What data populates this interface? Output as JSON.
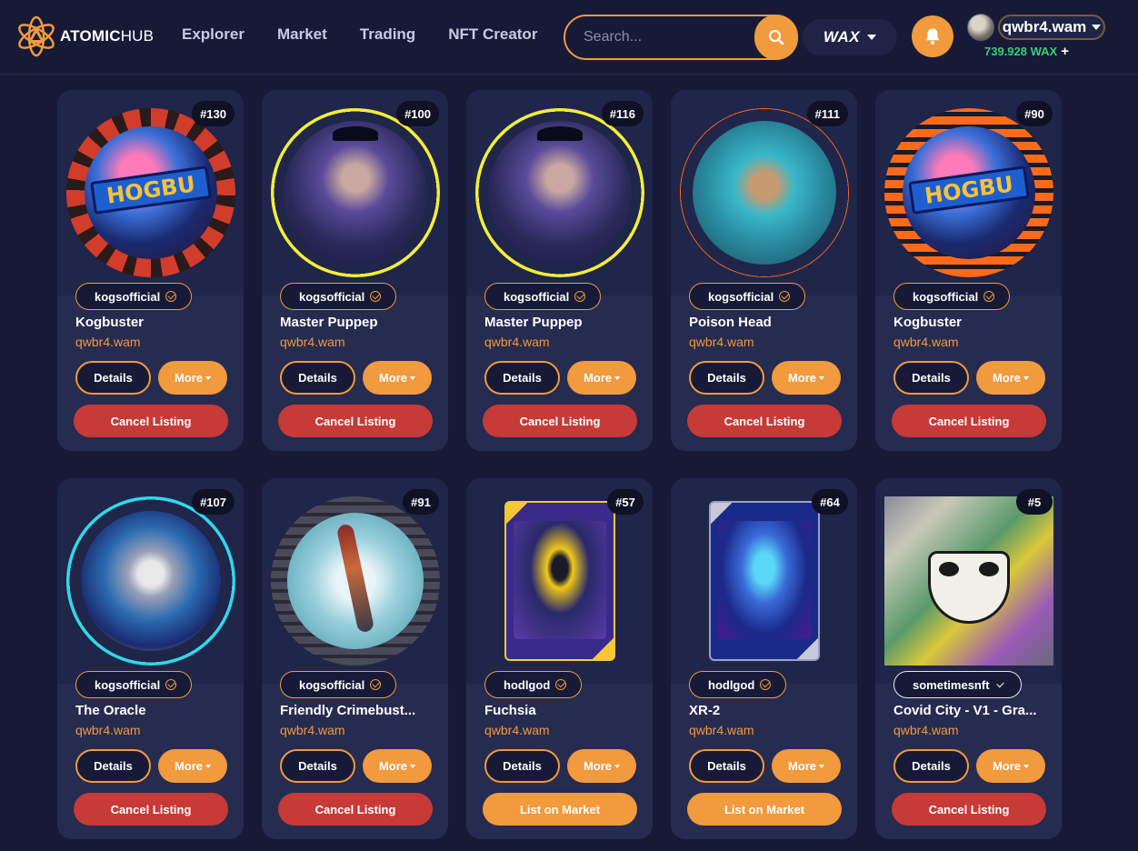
{
  "header": {
    "logo": {
      "text_bold": "ATOMIC",
      "text_light": "HUB"
    },
    "nav": [
      "Explorer",
      "Market",
      "Trading",
      "NFT Creator"
    ],
    "search": {
      "placeholder": "Search..."
    },
    "chain": {
      "label": "WAX"
    },
    "account": {
      "name": "qwbr4.wam",
      "balance": "739.928 WAX",
      "balance_add": "+"
    }
  },
  "colors": {
    "background": "#161a36",
    "card": "#222748",
    "accent": "#f19a3e",
    "cancel": "#c63a38",
    "balance": "#3dcc7a"
  },
  "cards": [
    {
      "mint": "#130",
      "collection": "kogsofficial",
      "name": "Kogbuster",
      "owner": "qwbr4.wam",
      "details": "Details",
      "more": "More",
      "action": "Cancel Listing",
      "action_type": "cancel",
      "art": "kogbuster-red"
    },
    {
      "mint": "#100",
      "collection": "kogsofficial",
      "name": "Master Puppep",
      "owner": "qwbr4.wam",
      "details": "Details",
      "more": "More",
      "action": "Cancel Listing",
      "action_type": "cancel",
      "art": "master-puppep"
    },
    {
      "mint": "#116",
      "collection": "kogsofficial",
      "name": "Master Puppep",
      "owner": "qwbr4.wam",
      "details": "Details",
      "more": "More",
      "action": "Cancel Listing",
      "action_type": "cancel",
      "art": "master-puppep"
    },
    {
      "mint": "#111",
      "collection": "kogsofficial",
      "name": "Poison Head",
      "owner": "qwbr4.wam",
      "details": "Details",
      "more": "More",
      "action": "Cancel Listing",
      "action_type": "cancel",
      "art": "poison-head"
    },
    {
      "mint": "#90",
      "collection": "kogsofficial",
      "name": "Kogbuster",
      "owner": "qwbr4.wam",
      "details": "Details",
      "more": "More",
      "action": "Cancel Listing",
      "action_type": "cancel",
      "art": "kogbuster-orange"
    },
    {
      "mint": "#107",
      "collection": "kogsofficial",
      "name": "The Oracle",
      "owner": "qwbr4.wam",
      "details": "Details",
      "more": "More",
      "action": "Cancel Listing",
      "action_type": "cancel",
      "art": "the-oracle"
    },
    {
      "mint": "#91",
      "collection": "kogsofficial",
      "name": "Friendly Crimebust...",
      "owner": "qwbr4.wam",
      "details": "Details",
      "more": "More",
      "action": "Cancel Listing",
      "action_type": "cancel",
      "art": "crimebuster"
    },
    {
      "mint": "#57",
      "collection": "hodlgod",
      "name": "Fuchsia",
      "owner": "qwbr4.wam",
      "details": "Details",
      "more": "More",
      "action": "List on Market",
      "action_type": "list",
      "art": "fuchsia"
    },
    {
      "mint": "#64",
      "collection": "hodlgod",
      "name": "XR-2",
      "owner": "qwbr4.wam",
      "details": "Details",
      "more": "More",
      "action": "List on Market",
      "action_type": "list",
      "art": "xr-2"
    },
    {
      "mint": "#5",
      "collection": "sometimesnft",
      "name": "Covid City - V1 - Gra...",
      "owner": "qwbr4.wam",
      "details": "Details",
      "more": "More",
      "action": "Cancel Listing",
      "action_type": "cancel",
      "art": "covid-city"
    }
  ]
}
